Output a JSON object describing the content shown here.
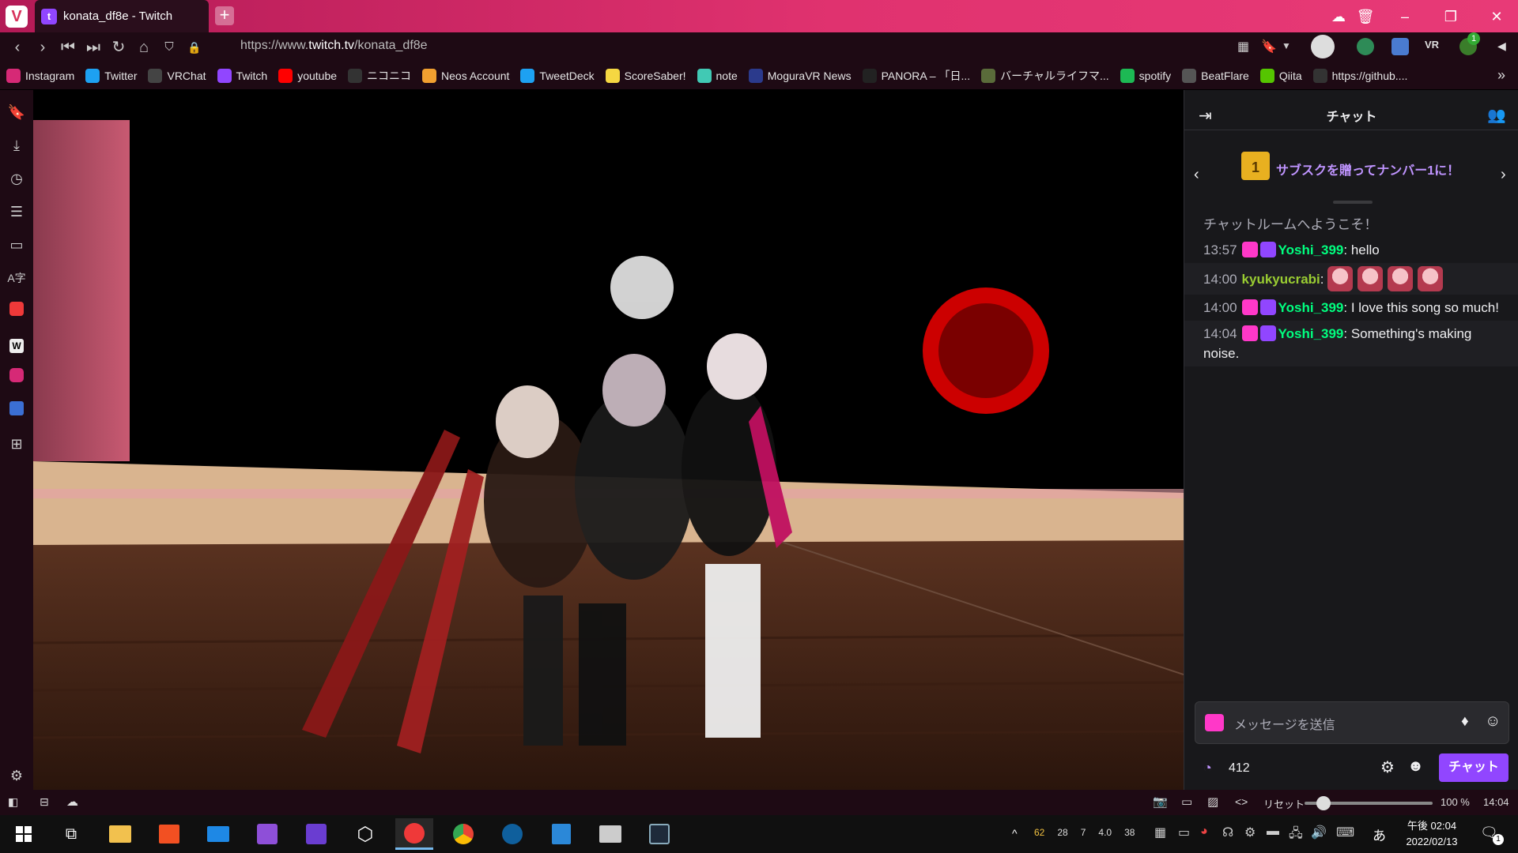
{
  "tab": {
    "title": "konata_df8e - Twitch"
  },
  "address": {
    "url_prefix": "https://www.",
    "url_host": "twitch.tv",
    "url_path": "/konata_df8e"
  },
  "extension_badge": "1",
  "bookmarks": [
    {
      "label": "Instagram",
      "icon": "instagram-icon",
      "color": "#d62976"
    },
    {
      "label": "Twitter",
      "icon": "twitter-icon",
      "color": "#1da1f2"
    },
    {
      "label": "VRChat",
      "icon": "vrchat-icon",
      "color": "#444444"
    },
    {
      "label": "Twitch",
      "icon": "twitch-icon",
      "color": "#9146ff"
    },
    {
      "label": "youtube",
      "icon": "youtube-icon",
      "color": "#ff0000"
    },
    {
      "label": "ニコニコ",
      "icon": "niconico-icon",
      "color": "#333333"
    },
    {
      "label": "Neos Account",
      "icon": "neos-icon",
      "color": "#f0a030"
    },
    {
      "label": "TweetDeck",
      "icon": "tweetdeck-icon",
      "color": "#1da1f2"
    },
    {
      "label": "ScoreSaber!",
      "icon": "scoresaber-icon",
      "color": "#f5d742"
    },
    {
      "label": "note",
      "icon": "note-icon",
      "color": "#41c9b4"
    },
    {
      "label": "MoguraVR News",
      "icon": "moguravr-icon",
      "color": "#2b3a8c"
    },
    {
      "label": "PANORA – 「日...",
      "icon": "panora-icon",
      "color": "#222222"
    },
    {
      "label": "バーチャルライフマ...",
      "icon": "virtuallife-icon",
      "color": "#5a6b3a"
    },
    {
      "label": "spotify",
      "icon": "spotify-icon",
      "color": "#1db954"
    },
    {
      "label": "BeatFlare",
      "icon": "beatflare-icon",
      "color": "#555555"
    },
    {
      "label": "Qiita",
      "icon": "qiita-icon",
      "color": "#55c500"
    },
    {
      "label": "https://github....",
      "icon": "github-icon",
      "color": "#333333"
    }
  ],
  "chat": {
    "header_title": "チャット",
    "gift_banner": "サブスクを贈ってナンバー1に！",
    "welcome": "チャットルームへようこそ！",
    "messages": [
      {
        "time": "13:57",
        "user": "Yoshi_399",
        "text": ": hello",
        "user_color": "#00ff7f",
        "badges": true
      },
      {
        "time": "14:00",
        "user": "kyukyucrabi",
        "text": ":",
        "user_color": "#9acd32",
        "badges": false,
        "emotes": 4
      },
      {
        "time": "14:00",
        "user": "Yoshi_399",
        "text": ": I love this song so much!",
        "user_color": "#00ff7f",
        "badges": true
      },
      {
        "time": "14:04",
        "user": "Yoshi_399",
        "text": ": Something's making noise.",
        "user_color": "#00ff7f",
        "badges": true
      }
    ],
    "input_placeholder": "メッセージを送信",
    "points": "412",
    "send_label": "チャット"
  },
  "statusbar": {
    "reset_label": "リセット",
    "zoom": "100 %",
    "clock": "14:04",
    "zoom_level": 0.15
  },
  "tray": {
    "nums": [
      "62",
      "28",
      "7",
      "4.0",
      "38"
    ],
    "time": "午後 02:04",
    "date": "2022/02/13",
    "ime": "あ",
    "notif_count": "1"
  },
  "colors": {
    "twitch_purple": "#9146ff",
    "accent": "#d8315b"
  }
}
